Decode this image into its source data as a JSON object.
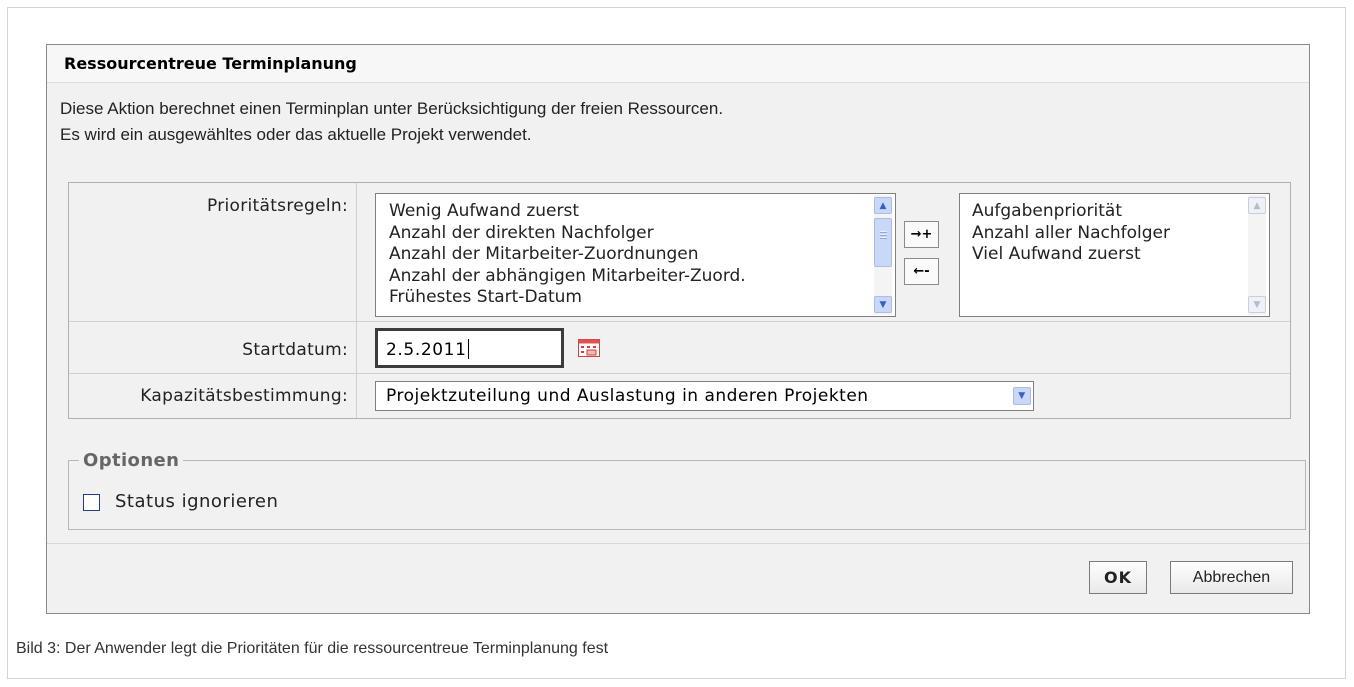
{
  "dialog": {
    "title": "Ressourcentreue Terminplanung",
    "description_line1": "Diese Aktion berechnet einen Terminplan unter Berücksichtigung der freien Ressourcen.",
    "description_line2": "Es wird ein ausgewähltes oder das aktuelle Projekt verwendet."
  },
  "form": {
    "priority_label": "Prioritätsregeln:",
    "available_rules": [
      "Wenig Aufwand zuerst",
      "Anzahl der direkten Nachfolger",
      "Anzahl der Mitarbeiter-Zuordnungen",
      "Anzahl der abhängigen Mitarbeiter-Zuord.",
      "Frühestes Start-Datum"
    ],
    "selected_rules": [
      "Aufgabenpriorität",
      "Anzahl aller Nachfolger",
      "Viel Aufwand zuerst"
    ],
    "add_button": "→+",
    "remove_button": "←-",
    "startdate_label": "Startdatum:",
    "startdate_value": "2.5.2011",
    "capacity_label": "Kapazitätsbestimmung:",
    "capacity_value": "Projektzuteilung und Auslastung in anderen Projekten"
  },
  "options": {
    "legend": "Optionen",
    "ignore_status_label": "Status ignorieren",
    "ignore_status_checked": false
  },
  "buttons": {
    "ok": "OK",
    "cancel": "Abbrechen"
  },
  "caption": "Bild 3: Der Anwender legt die Prioritäten für die ressourcentreue Terminplanung fest",
  "icons": {
    "scroll_up": "chevron-up-icon",
    "scroll_down": "chevron-down-icon",
    "calendar": "calendar-icon",
    "dropdown": "chevron-down-icon"
  },
  "colors": {
    "dialog_background": "#f1f1f1",
    "scrollbar_accent": "#c9d8f7"
  }
}
